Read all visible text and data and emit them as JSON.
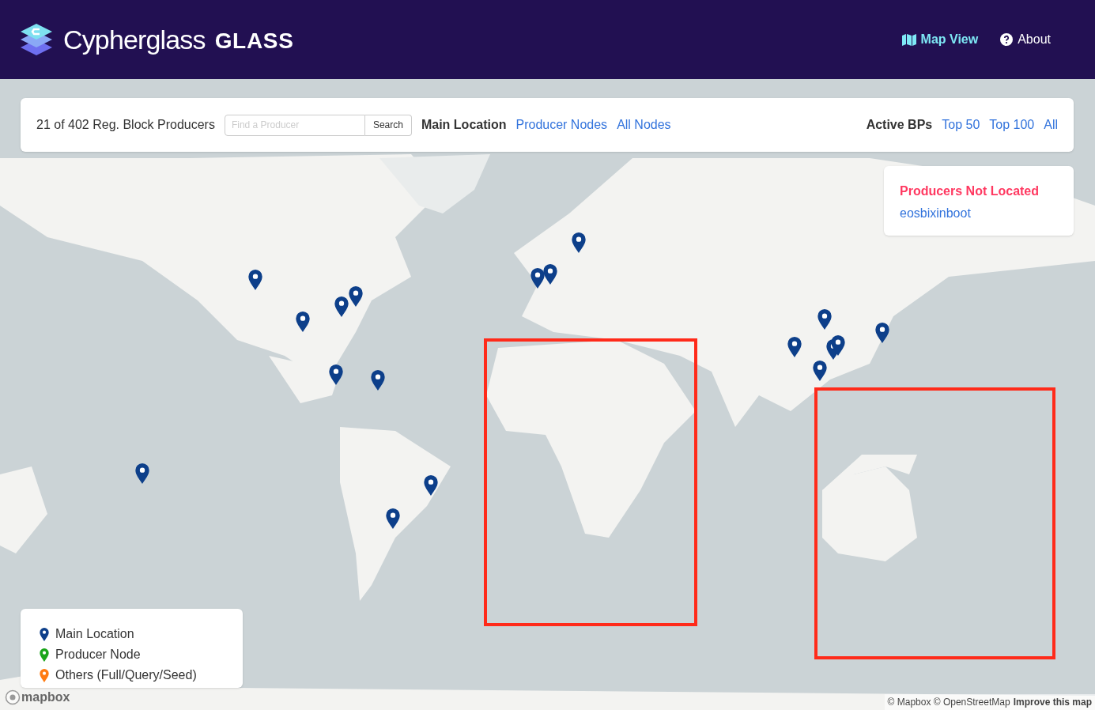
{
  "header": {
    "brand": "Cypherglass",
    "product": "GLASS",
    "nav": [
      {
        "label": "Map View",
        "kind": "map",
        "selected": true
      },
      {
        "label": "About",
        "kind": "help",
        "selected": false
      }
    ]
  },
  "toolbar": {
    "count": "21 of 402 Reg. Block Producers",
    "search": {
      "placeholder": "Find a Producer",
      "button": "Search"
    },
    "location_filters": [
      {
        "label": "Main Location",
        "selected": true
      },
      {
        "label": "Producer Nodes",
        "selected": false
      },
      {
        "label": "All Nodes",
        "selected": false
      }
    ],
    "bp_label": "Active BPs",
    "bp_filters": [
      {
        "label": "Top 50"
      },
      {
        "label": "Top 100"
      },
      {
        "label": "All"
      }
    ]
  },
  "not_located": {
    "title": "Producers Not Located",
    "producers": [
      "eosbixinboot"
    ]
  },
  "map": {
    "kind": "picture",
    "markers": [
      {
        "kind": "main"
      },
      {
        "kind": "main"
      },
      {
        "kind": "main"
      },
      {
        "kind": "main"
      },
      {
        "kind": "main"
      },
      {
        "kind": "main"
      },
      {
        "kind": "main"
      },
      {
        "kind": "main"
      },
      {
        "kind": "main"
      },
      {
        "kind": "main"
      },
      {
        "kind": "main"
      },
      {
        "kind": "main"
      },
      {
        "kind": "main"
      },
      {
        "kind": "main"
      },
      {
        "kind": "main"
      },
      {
        "kind": "main"
      },
      {
        "kind": "main"
      },
      {
        "kind": "main"
      }
    ]
  },
  "legend": [
    {
      "label": "Main Location",
      "kind": "main"
    },
    {
      "label": "Producer Node",
      "kind": "producer"
    },
    {
      "label": "Others (Full/Query/Seed)",
      "kind": "other"
    }
  ],
  "logo": "mapbox",
  "attribution": {
    "text": "© Mapbox © OpenStreetMap",
    "link": "Improve this map"
  }
}
